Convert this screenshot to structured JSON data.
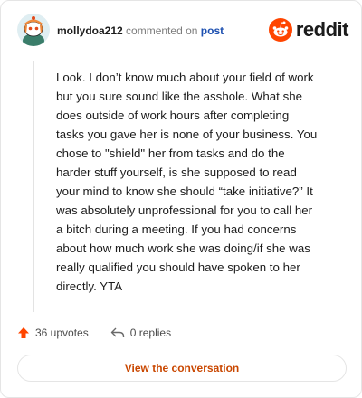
{
  "comment": {
    "username": "mollydoa212",
    "action_text": "commented on",
    "target_link": "post",
    "text": "Look. I don’t know much about your field of work\nbut you sure sound like the asshole. What she\ndoes outside of work hours after completing\ntasks you gave her is none of your business. You\nchose to \"shield\" her from tasks and do the\nharder stuff yourself, is she supposed to read\nyour mind to know she should “take initiative?” It\nwas absolutely unprofessional for you to call her\na bitch during a meeting. If you had concerns\nabout how much work she was doing/if she was\nreally qualified you should have spoken to her\ndirectly. YTA"
  },
  "brand": {
    "name": "reddit",
    "accent": "#ff4500"
  },
  "stats": {
    "upvotes": "36 upvotes",
    "replies": "0 replies"
  },
  "cta": {
    "label": "View the conversation"
  },
  "icons": {
    "avatar": "snoo-avatar",
    "logo": "reddit-alien-icon",
    "upvote": "upvote-arrow-icon",
    "reply": "reply-arrow-icon"
  },
  "colors": {
    "upvote": "#ff4500",
    "cta_text": "#c94700",
    "link": "#1c4fb0"
  }
}
